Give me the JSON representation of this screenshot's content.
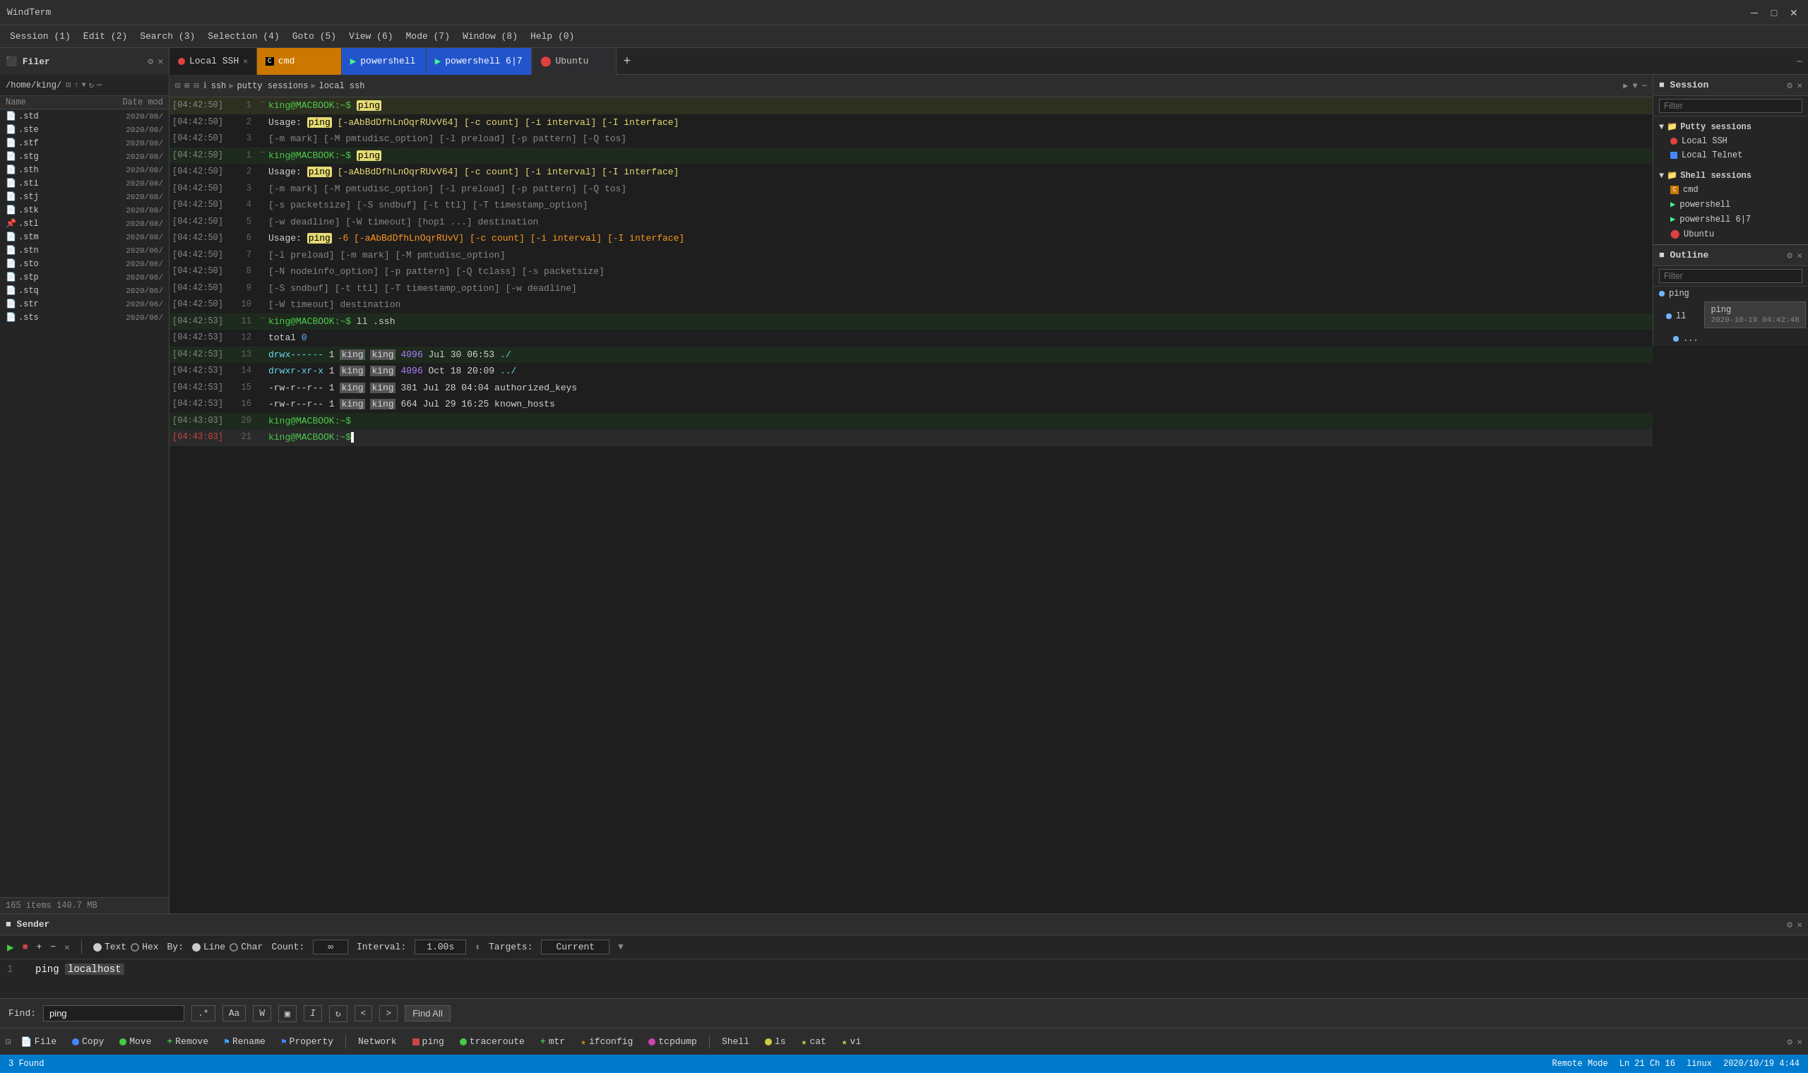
{
  "titleBar": {
    "title": "WindTerm",
    "minimizeLabel": "─",
    "maximizeLabel": "□",
    "closeLabel": "✕"
  },
  "menuBar": {
    "items": [
      {
        "label": "Session (1)"
      },
      {
        "label": "Edit (2)"
      },
      {
        "label": "Search (3)"
      },
      {
        "label": "Selection (4)"
      },
      {
        "label": "Goto (5)"
      },
      {
        "label": "View (6)"
      },
      {
        "label": "Mode (7)"
      },
      {
        "label": "Window (8)"
      },
      {
        "label": "Help (0)"
      }
    ]
  },
  "tabs": [
    {
      "label": "Local SSH",
      "color": "#e04040",
      "active": true,
      "type": "dot"
    },
    {
      "label": "cmd",
      "color": "#ff8c00",
      "active": false,
      "type": "square",
      "bg": "#cc7700"
    },
    {
      "label": "powershell",
      "color": "#2255cc",
      "active": false,
      "type": "arrow",
      "bg": "#2255cc"
    },
    {
      "label": "powershell 6|7",
      "color": "#2255cc",
      "active": false,
      "type": "arrow",
      "bg": "#2255cc"
    },
    {
      "label": "Ubuntu",
      "color": "#e04040",
      "active": false,
      "type": "ubuntu"
    }
  ],
  "filer": {
    "title": "Filer",
    "path": "/home/king/",
    "colName": "Name",
    "colDate": "Date mod",
    "items": [
      {
        "name": ".std",
        "date": "2020/08/"
      },
      {
        "name": ".ste",
        "date": "2020/08/"
      },
      {
        "name": ".stf",
        "date": "2020/08/"
      },
      {
        "name": ".stg",
        "date": "2020/08/"
      },
      {
        "name": ".sth",
        "date": "2020/08/"
      },
      {
        "name": ".sti",
        "date": "2020/08/"
      },
      {
        "name": ".stj",
        "date": "2020/08/"
      },
      {
        "name": ".stk",
        "date": "2020/08/"
      },
      {
        "name": ".stl",
        "date": "2020/08/",
        "special": true
      },
      {
        "name": ".stm",
        "date": "2020/08/"
      },
      {
        "name": ".stn",
        "date": "2020/06/"
      },
      {
        "name": ".sto",
        "date": "2020/06/"
      },
      {
        "name": ".stp",
        "date": "2020/06/"
      },
      {
        "name": ".stq",
        "date": "2020/06/"
      },
      {
        "name": ".str",
        "date": "2020/06/"
      },
      {
        "name": ".sts",
        "date": "2020/06/"
      }
    ],
    "status": "165 items 140.7 MB"
  },
  "terminal": {
    "breadcrumb": {
      "ssh": "ssh",
      "sep1": "▶",
      "putty": "putty sessions",
      "sep2": "▶",
      "local": "local ssh"
    },
    "lines": [
      {
        "ts": "[04:42:50]",
        "num": 1,
        "indicator": "─",
        "content": "prompt_ping",
        "highlight": "yellow"
      },
      {
        "ts": "[04:42:50]",
        "num": 2,
        "content": "usage_ping_1"
      },
      {
        "ts": "[04:42:50]",
        "num": 3,
        "content": "usage_ping_1b"
      },
      {
        "ts": "[04:42:50]",
        "num": 1,
        "indicator": "─",
        "content": "prompt_ping2",
        "highlight": "green"
      },
      {
        "ts": "[04:42:50]",
        "num": 2,
        "content": "usage_ping_2"
      },
      {
        "ts": "[04:42:50]",
        "num": 3,
        "content": "usage_ping_2b"
      },
      {
        "ts": "[04:42:50]",
        "num": 4,
        "content": "usage_ping_3"
      },
      {
        "ts": "[04:42:50]",
        "num": 5,
        "content": "usage_ping_4"
      },
      {
        "ts": "[04:42:50]",
        "num": 6,
        "content": "usage_ping_5"
      },
      {
        "ts": "[04:42:50]",
        "num": 7,
        "content": "usage_ping_5b"
      },
      {
        "ts": "[04:42:50]",
        "num": 8,
        "content": "usage_ping_6"
      },
      {
        "ts": "[04:42:50]",
        "num": 9,
        "content": "usage_ping_7"
      },
      {
        "ts": "[04:42:50]",
        "num": 10,
        "content": "usage_ping_8"
      },
      {
        "ts": "[04:42:53]",
        "num": 11,
        "indicator": "─",
        "content": "prompt_ll",
        "highlight": "green2"
      },
      {
        "ts": "[04:42:53]",
        "num": 12,
        "content": "total_0"
      },
      {
        "ts": "[04:42:53]",
        "num": 13,
        "content": "ls_1"
      },
      {
        "ts": "[04:42:53]",
        "num": 14,
        "content": "ls_2"
      },
      {
        "ts": "[04:42:53]",
        "num": 15,
        "content": "ls_3"
      },
      {
        "ts": "[04:42:53]",
        "num": 16,
        "content": "ls_4"
      },
      {
        "ts": "[04:43:03]",
        "num": 20,
        "content": "prompt_empty1"
      },
      {
        "ts": "[04:43:03]",
        "num": 21,
        "content": "prompt_cursor",
        "active": true
      }
    ]
  },
  "session": {
    "title": "Session",
    "filterPlaceholder": "Filter",
    "puttyGroup": "Putty sessions",
    "puttyItems": [
      {
        "label": "Local SSH",
        "color": "#e04040",
        "type": "dot"
      },
      {
        "label": "Local Telnet",
        "color": "#4488ff",
        "type": "square"
      }
    ],
    "shellGroup": "Shell sessions",
    "shellItems": [
      {
        "label": "cmd",
        "color": "#cc7700",
        "type": "square"
      },
      {
        "label": "powershell",
        "color": "#4466cc",
        "type": "arrow"
      },
      {
        "label": "powershell 6|7",
        "color": "#4466cc",
        "type": "arrow"
      },
      {
        "label": "Ubuntu",
        "color": "#e04040",
        "type": "ubuntu"
      }
    ]
  },
  "outline": {
    "title": "Outline",
    "filterPlaceholder": "Filter",
    "items": [
      {
        "label": "ping"
      },
      {
        "label": "ll"
      },
      {
        "label": "..."
      }
    ],
    "tooltip": {
      "cmd": "ping",
      "date": "2020-10-19 04:42:48"
    }
  },
  "sender": {
    "title": "Sender",
    "controls": {
      "playLabel": "▶",
      "stopLabel": "■",
      "addLabel": "+",
      "removeLabel": "−",
      "closeLabel": "✕",
      "textLabel": "Text",
      "hexLabel": "Hex",
      "byLabel": "By:",
      "lineLabel": "Line",
      "charLabel": "Char",
      "countLabel": "Count:",
      "countValue": "∞",
      "intervalLabel": "Interval:",
      "intervalValue": "1.00s",
      "targetsLabel": "Targets:",
      "targetsValue": "Current"
    },
    "line1": "1",
    "content": "ping localhost"
  },
  "findBar": {
    "findLabel": "Find:",
    "findValue": "ping",
    "regexLabel": ".*",
    "caseLabel": "Aa",
    "wordLabel": "W",
    "contextLabel": "▣",
    "italicLabel": "I",
    "wrapLabel": "↻",
    "prevLabel": "<",
    "nextLabel": ">",
    "findAllLabel": "Find All",
    "results": "3 Found"
  },
  "toolbar": {
    "buttons": [
      {
        "label": "File",
        "icon": "page"
      },
      {
        "label": "Copy",
        "color": "#4488ff",
        "dot": true
      },
      {
        "label": "Move",
        "color": "#44cc44",
        "dot": true
      },
      {
        "label": "Remove",
        "color": "#44cc44",
        "plus": true
      },
      {
        "label": "Rename",
        "color": "#44aaff",
        "flag": true
      },
      {
        "label": "Property",
        "color": "#4488ff",
        "flag": true
      },
      {
        "label": "Network",
        "plain": true
      },
      {
        "label": "ping",
        "color": "#cc4444",
        "sq": true
      },
      {
        "label": "traceroute",
        "color": "#44cc44",
        "dot": true
      },
      {
        "label": "mtr",
        "color": "#44cc44",
        "plus": true
      },
      {
        "label": "ifconfig",
        "color": "#cc8800",
        "star": true
      },
      {
        "label": "tcpdump",
        "color": "#cc44aa",
        "dot": true
      },
      {
        "label": "Shell",
        "plain": true
      },
      {
        "label": "ls",
        "color": "#cccc44",
        "dot": true
      },
      {
        "label": "cat",
        "color": "#cccc44",
        "star": true
      },
      {
        "label": "vi",
        "color": "#cccc44",
        "star": true
      }
    ]
  },
  "statusBar": {
    "left": {
      "icon": "▣",
      "mode": "Remote Mode"
    },
    "right": {
      "position": "Ln 21 Ch 16",
      "os": "linux",
      "datetime": "2020/10/19 4:44"
    }
  }
}
